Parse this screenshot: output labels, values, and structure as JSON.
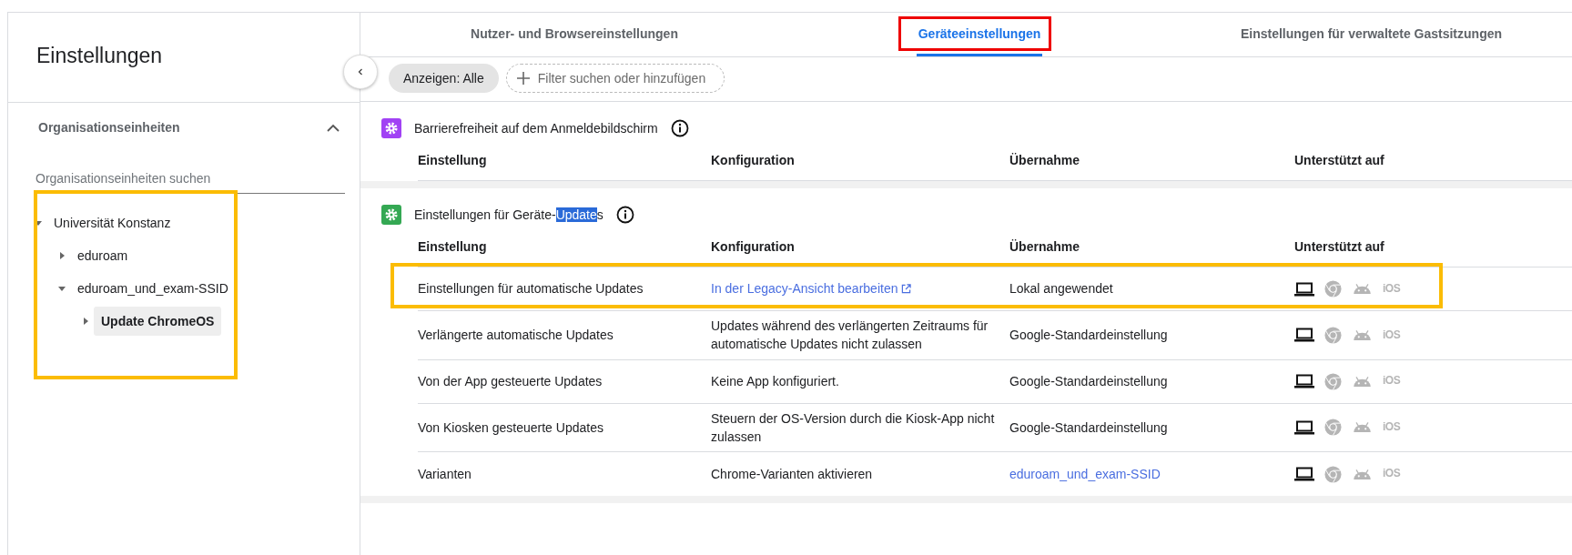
{
  "sidebar": {
    "title": "Einstellungen",
    "panel_title": "Organisationseinheiten",
    "panel_expanded": true,
    "search": {
      "placeholder": "Organisationseinheiten suchen"
    },
    "tree_highlighted": true,
    "tree": [
      {
        "label": "Universität Konstanz",
        "expanded": true,
        "selected": false,
        "children": [
          {
            "label": "eduroam",
            "expanded": false,
            "selected": false
          },
          {
            "label": "eduroam_und_exam-SSID",
            "expanded": true,
            "selected": false,
            "children": [
              {
                "label": "Update ChromeOS",
                "expanded": false,
                "selected": true
              }
            ]
          }
        ]
      }
    ]
  },
  "tabs": [
    {
      "label": "Nutzer- und Browsereinstellungen",
      "selected": false,
      "highlighted": false
    },
    {
      "label": "Geräteeinstellungen",
      "selected": true,
      "highlighted": true
    },
    {
      "label": "Einstellungen für verwaltete Gastsitzungen",
      "selected": false,
      "highlighted": false
    }
  ],
  "filter": {
    "chip": "Anzeigen: Alle",
    "placeholder": "Filter suchen oder hinzufügen"
  },
  "sections": [
    {
      "color": "#a142f4",
      "title": [
        {
          "text": "Barrierefreiheit auf dem Anmeldebildschirm",
          "selected": false
        }
      ],
      "columns": [
        "Einstellung",
        "Konfiguration",
        "Übernahme",
        "Unterstützt auf"
      ]
    },
    {
      "color": "#34a853",
      "title": [
        {
          "text": "Einstellungen für Geräte-",
          "selected": false
        },
        {
          "text": "Update",
          "selected": true
        },
        {
          "text": "s",
          "selected": false
        }
      ],
      "columns": [
        "Einstellung",
        "Konfiguration",
        "Übernahme",
        "Unterstützt auf"
      ],
      "rows": [
        {
          "setting": "Einstellungen für automatische Updates",
          "config": "In der Legacy-Ansicht bearbeiten",
          "config_link": true,
          "inheritance": "Lokal angewendet",
          "inheritance_link": false,
          "highlighted": true,
          "platforms": [
            {
              "kind": "laptop",
              "supported": true
            },
            {
              "kind": "chrome",
              "supported": false
            },
            {
              "kind": "android",
              "supported": false
            },
            {
              "kind": "ios",
              "label": "iOS",
              "supported": false
            }
          ]
        },
        {
          "setting": "Verlängerte automatische Updates",
          "config": "Updates während des verlängerten Zeitraums für automatische Updates nicht zulassen",
          "config_link": false,
          "inheritance": "Google-Standardeinstellung",
          "inheritance_link": false,
          "highlighted": false,
          "platforms": [
            {
              "kind": "laptop",
              "supported": true
            },
            {
              "kind": "chrome",
              "supported": false
            },
            {
              "kind": "android",
              "supported": false
            },
            {
              "kind": "ios",
              "label": "iOS",
              "supported": false
            }
          ]
        },
        {
          "setting": "Von der App gesteuerte Updates",
          "config": "Keine App konfiguriert.",
          "config_link": false,
          "inheritance": "Google-Standardeinstellung",
          "inheritance_link": false,
          "highlighted": false,
          "platforms": [
            {
              "kind": "laptop",
              "supported": true
            },
            {
              "kind": "chrome",
              "supported": false
            },
            {
              "kind": "android",
              "supported": false
            },
            {
              "kind": "ios",
              "label": "iOS",
              "supported": false
            }
          ]
        },
        {
          "setting": "Von Kiosken gesteuerte Updates",
          "config": "Steuern der OS-Version durch die Kiosk-App nicht zulassen",
          "config_link": false,
          "inheritance": "Google-Standardeinstellung",
          "inheritance_link": false,
          "highlighted": false,
          "platforms": [
            {
              "kind": "laptop",
              "supported": true
            },
            {
              "kind": "chrome",
              "supported": false
            },
            {
              "kind": "android",
              "supported": false
            },
            {
              "kind": "ios",
              "label": "iOS",
              "supported": false
            }
          ]
        },
        {
          "setting": "Varianten",
          "config": "Chrome-Varianten aktivieren",
          "config_link": false,
          "inheritance": "eduroam_und_exam-SSID",
          "inheritance_link": true,
          "highlighted": false,
          "platforms": [
            {
              "kind": "laptop",
              "supported": true
            },
            {
              "kind": "chrome",
              "supported": false
            },
            {
              "kind": "android",
              "supported": false
            },
            {
              "kind": "ios",
              "label": "iOS",
              "supported": false
            }
          ]
        }
      ]
    }
  ]
}
